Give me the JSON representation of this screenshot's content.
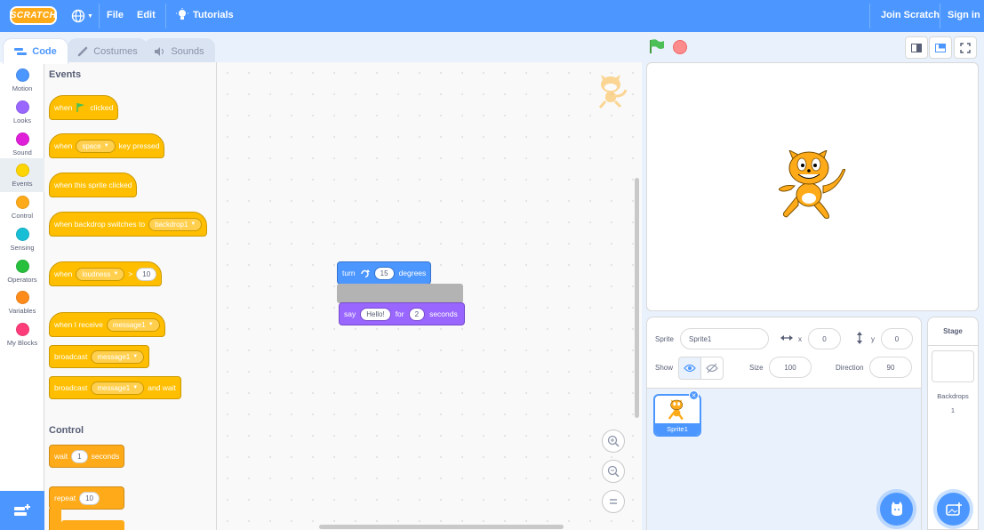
{
  "menubar": {
    "logo": "SCRATCH",
    "file": "File",
    "edit": "Edit",
    "tutorials": "Tutorials",
    "join": "Join Scratch",
    "signin": "Sign in",
    "bg_color": "#4c97ff"
  },
  "tabs": [
    {
      "label": "Code",
      "icon": "code-icon",
      "active": true
    },
    {
      "label": "Costumes",
      "icon": "brush-icon",
      "active": false
    },
    {
      "label": "Sounds",
      "icon": "speaker-icon",
      "active": false
    }
  ],
  "categories": [
    {
      "label": "Motion",
      "color": "#4c97ff"
    },
    {
      "label": "Looks",
      "color": "#9966ff"
    },
    {
      "label": "Sound",
      "color": "#cf63cf"
    },
    {
      "label": "Events",
      "color": "#ffd500",
      "selected": true
    },
    {
      "label": "Control",
      "color": "#ffab19"
    },
    {
      "label": "Sensing",
      "color": "#5cb1d6"
    },
    {
      "label": "Operators",
      "color": "#59c059"
    },
    {
      "label": "Variables",
      "color": "#ff8c1a"
    },
    {
      "label": "My Blocks",
      "color": "#ff6680"
    }
  ],
  "palette": {
    "events_heading": "Events",
    "control_heading": "Control",
    "when_flag": {
      "a": "when",
      "b": "clicked"
    },
    "when_key": {
      "a": "when",
      "key": "space",
      "b": "key pressed"
    },
    "when_sprite": "when this sprite clicked",
    "when_backdrop": {
      "a": "when backdrop switches to",
      "value": "backdrop1"
    },
    "when_loudness": {
      "a": "when",
      "value": "loudness",
      "op": ">",
      "num": "10"
    },
    "when_receive": {
      "a": "when I receive",
      "value": "message1"
    },
    "broadcast": {
      "a": "broadcast",
      "value": "message1"
    },
    "broadcast_wait": {
      "a": "broadcast",
      "value": "message1",
      "b": "and wait"
    },
    "wait": {
      "a": "wait",
      "num": "1",
      "b": "seconds"
    },
    "repeat": {
      "a": "repeat",
      "num": "10"
    }
  },
  "script": {
    "turn": {
      "a": "turn",
      "num": "15",
      "b": "degrees"
    },
    "say": {
      "a": "say",
      "text": "Hello!",
      "b": "for",
      "num": "2",
      "c": "seconds"
    }
  },
  "sprite_info": {
    "sprite_label": "Sprite",
    "sprite_name": "Sprite1",
    "x_label": "x",
    "x": "0",
    "y_label": "y",
    "y": "0",
    "show_label": "Show",
    "size_label": "Size",
    "size": "100",
    "direction_label": "Direction",
    "direction": "90"
  },
  "sprites": [
    {
      "name": "Sprite1"
    }
  ],
  "stage_pane": {
    "title": "Stage",
    "backdrops_label": "Backdrops",
    "backdrops_count": "1"
  },
  "colors": {
    "events": "#ffbf00",
    "control": "#ffab19",
    "motion": "#4c97ff",
    "looks": "#9966ff"
  }
}
